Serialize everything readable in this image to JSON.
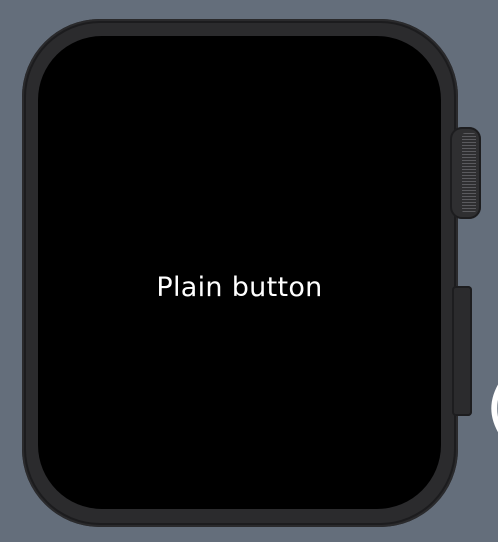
{
  "screen": {
    "button_label": "Plain button"
  },
  "edge": {
    "glyph": "("
  },
  "colors": {
    "background": "#646e7b",
    "watch_case": "#1c1c1e",
    "screen": "#000000",
    "text": "#ffffff"
  }
}
